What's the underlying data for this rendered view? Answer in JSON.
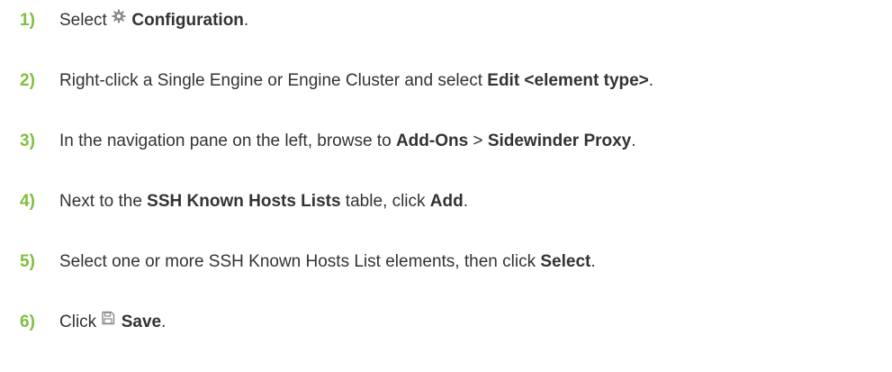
{
  "steps": [
    {
      "number": "1)",
      "t1": "Select ",
      "icon": "gear-icon",
      "t2": " ",
      "b1": "Configuration",
      "t3": "."
    },
    {
      "number": "2)",
      "t1": "Right-click a Single Engine or Engine Cluster and select ",
      "b1": "Edit <element type>",
      "t2": "."
    },
    {
      "number": "3)",
      "t1": "In the navigation pane on the left, browse to ",
      "b1": "Add-Ons",
      "t2": " > ",
      "b2": "Sidewinder Proxy",
      "t3": "."
    },
    {
      "number": "4)",
      "t1": "Next to the ",
      "b1": "SSH Known Hosts Lists",
      "t2": " table, click ",
      "b2": "Add",
      "t3": "."
    },
    {
      "number": "5)",
      "t1": "Select one or more SSH Known Hosts List elements, then click ",
      "b1": "Select",
      "t2": "."
    },
    {
      "number": "6)",
      "t1": "Click ",
      "icon": "save-icon",
      "t2": " ",
      "b1": "Save",
      "t3": "."
    }
  ],
  "colors": {
    "step_number": "#7fbf3f",
    "text": "#333333",
    "icon": "#8a8a8a"
  }
}
